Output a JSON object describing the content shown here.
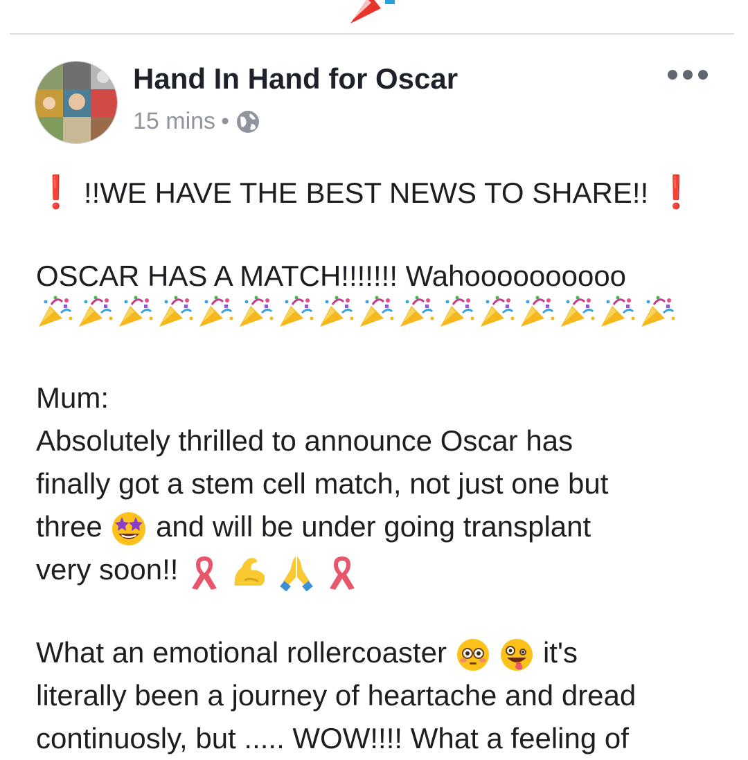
{
  "header": {
    "page_name": "Hand In Hand for Oscar",
    "timestamp": "15 mins",
    "separator": "•",
    "privacy_icon": "globe-icon",
    "menu_icon": "more-horizontal-icon"
  },
  "post": {
    "headline": "!!WE HAVE THE BEST NEWS TO SHARE!!",
    "match_line": "OSCAR HAS A MATCH!!!!!!! Wahoooooooooo",
    "party_popper_count": 16,
    "mum_label": "Mum:",
    "line1": "Absolutely thrilled to announce Oscar has",
    "line2": "finally got a stem cell match, not just one but",
    "line3a": "three",
    "line3b": "and will be under going transplant",
    "line4": "very soon!!",
    "line5a": "What an emotional rollercoaster",
    "line5b": "it's",
    "line6": "literally been a journey of heartache and dread",
    "line7": "continuosly, but ..... WOW!!!! What a feeling of"
  },
  "colors": {
    "text": "#1c1e21",
    "name": "#1d2129",
    "meta": "#90949c",
    "exclamation": "#e0242c",
    "divider": "#dddfe2"
  }
}
